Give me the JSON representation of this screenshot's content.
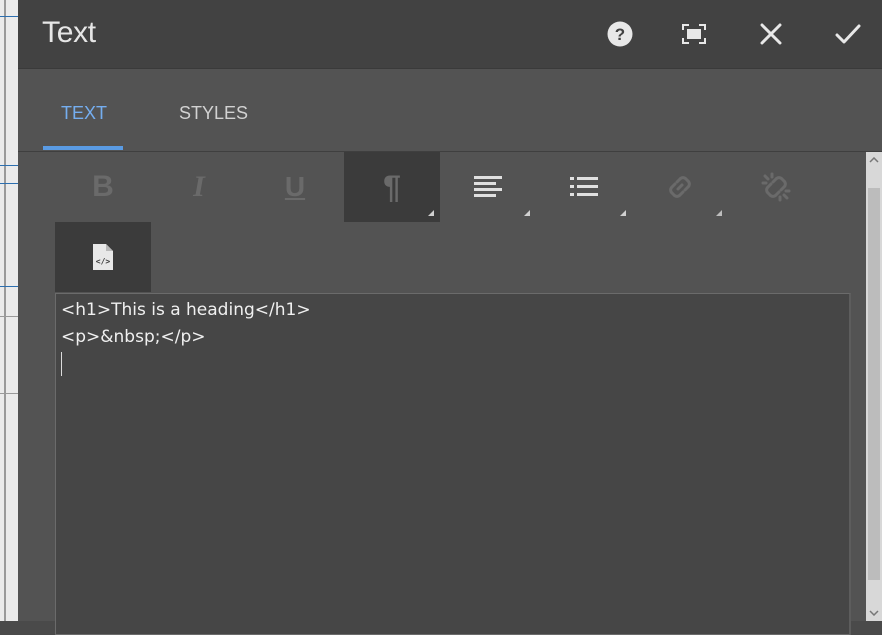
{
  "dialog": {
    "title": "Text"
  },
  "header_buttons": [
    {
      "name": "help",
      "icon": "help-icon"
    },
    {
      "name": "fullscreen",
      "icon": "fullscreen-icon"
    },
    {
      "name": "cancel",
      "icon": "close-icon"
    },
    {
      "name": "done",
      "icon": "checkmark-icon"
    }
  ],
  "tabs": [
    {
      "label": "TEXT",
      "active": true
    },
    {
      "label": "STYLES",
      "active": false
    }
  ],
  "toolbar": {
    "bold_glyph": "B",
    "italic_glyph": "I",
    "underline_glyph": "U",
    "paragraph_glyph": "¶"
  },
  "editor": {
    "lines": [
      "<h1>This is a heading</h1>",
      "<p>&nbsp;</p>"
    ]
  },
  "colors": {
    "accent": "#75aef0",
    "header_bg": "#424242",
    "panel_bg": "#535353",
    "editor_bg": "#464646"
  }
}
